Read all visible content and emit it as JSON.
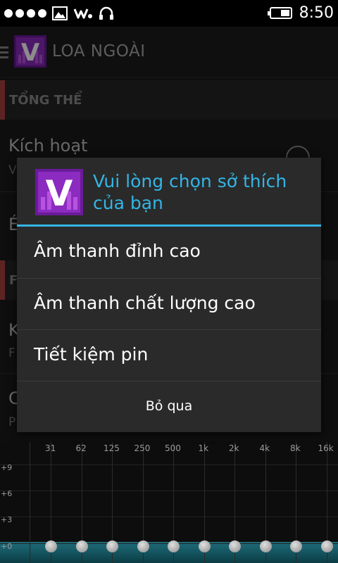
{
  "status_bar": {
    "time": "8:50",
    "icons": [
      "signal-dots-icon",
      "image-icon",
      "walkman-icon",
      "headphones-icon",
      "battery-icon"
    ]
  },
  "action_bar": {
    "title": "LOA NGOÀI",
    "logo_letter": "V"
  },
  "background": {
    "section1_header": "TỔNG THỂ",
    "row1_title": "Kích hoạt",
    "row1_sub": "V",
    "row2_title": "É",
    "section2_header": "F",
    "row3_title": "K",
    "row3_sub": "F",
    "row4_title": "C",
    "row4_sub": "P"
  },
  "equalizer": {
    "frequencies": [
      "31",
      "62",
      "125",
      "250",
      "500",
      "1k",
      "2k",
      "4k",
      "8k",
      "16k"
    ],
    "db_labels": [
      "+9",
      "+6",
      "+3",
      "+0"
    ],
    "band_levels_db": [
      0,
      0,
      0,
      0,
      0,
      0,
      0,
      0,
      0,
      0
    ]
  },
  "dialog": {
    "logo_letter": "V",
    "title": "Vui lòng chọn sở thích của bạn",
    "options": [
      "Âm thanh đỉnh cao",
      "Âm thanh chất lượng cao",
      "Tiết kiệm pin"
    ],
    "cancel_label": "Bỏ qua"
  },
  "colors": {
    "accent": "#33b5e5",
    "dialog_bg": "#2a2a2a",
    "section_marker": "#a94040",
    "logo_purple": "#7a1fa8"
  }
}
